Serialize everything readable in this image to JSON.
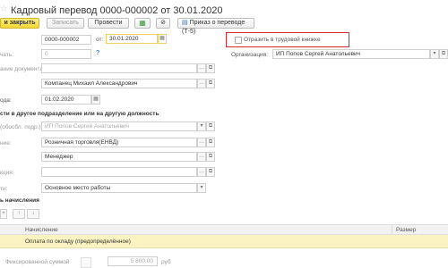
{
  "window": {
    "title": "Кадровый перевод 0000-000002 от 30.01.2020"
  },
  "toolbar": {
    "post_close_label": "и закрыть",
    "save_label": "Записать",
    "post_label": "Провести",
    "print_label": "Приказ о переводе (Т-5)"
  },
  "header": {
    "number_value": "0000-000002",
    "date_prefix": "от:",
    "date_value": "30.01.2020",
    "workbook_checkbox_label": "Отразить в трудовой книжке",
    "organization_label": "Организация:",
    "organization_value": "ИП Попов Сергей Анатольевич"
  },
  "fields": {
    "row2_label": "чать:",
    "row2_value": "0",
    "doc_label": "ание документа:",
    "employee_value": "Компанец Михаил Александрович",
    "from_label": "ода:",
    "from_value": "01.02.2020"
  },
  "transfer_section": {
    "title": "сти в другое подразделение или на другую должность",
    "org_label": "(обосбл. подр.):",
    "org_value": "ИП Попов Сергей Анатольевич",
    "dept_label": "ние:",
    "dept_value": "Розничная торговля(ЕНВД)",
    "position_value": "Менеджер",
    "func_label": "кция:",
    "type_label": "ти:",
    "type_value": "Основное место работы"
  },
  "accruals": {
    "title": "ь начисления",
    "columns": [
      "Начисление",
      "Размер"
    ],
    "rows": [
      {
        "name": "Оплата по окладу (предопределённое)"
      }
    ],
    "footer_label": "Фиксированной суммой",
    "footer_amount": "5 800,00",
    "footer_currency": "руб"
  },
  "icons": {
    "star": "star-icon",
    "calendar": "calendar-icon",
    "select": "ellipsis-icon",
    "open": "open-icon",
    "help": "question-icon",
    "printer": "printer-icon"
  }
}
